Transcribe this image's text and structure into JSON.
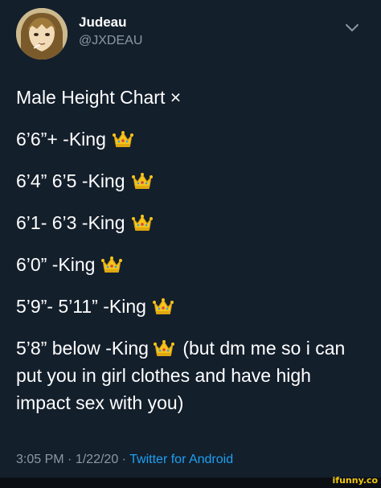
{
  "author": {
    "name": "Judeau",
    "handle": "@JXDEAU"
  },
  "tweet": {
    "title": "Male Height Chart ×",
    "lines": [
      "6’6”+ -King",
      "6’4” 6’5 -King",
      "6’1- 6’3 -King",
      "6’0” -King",
      "5’9”- 5’11” -King"
    ],
    "last_line_before": "5’8” below -King",
    "last_line_after": "(but dm me so i can put you in girl clothes and have high impact sex with you)"
  },
  "meta": {
    "time": "3:05 PM",
    "separator1": "·",
    "date": "1/22/20",
    "separator2": "·",
    "source": "Twitter for Android"
  },
  "watermark": "ifunny.co",
  "icons": {
    "crown": "crown-emoji",
    "chevron": "chevron-down-icon",
    "avatar": "avatar-anime-character"
  },
  "colors": {
    "background": "#141f2c",
    "text": "#ffffff",
    "muted": "#8899a6",
    "link": "#1da1f2"
  }
}
